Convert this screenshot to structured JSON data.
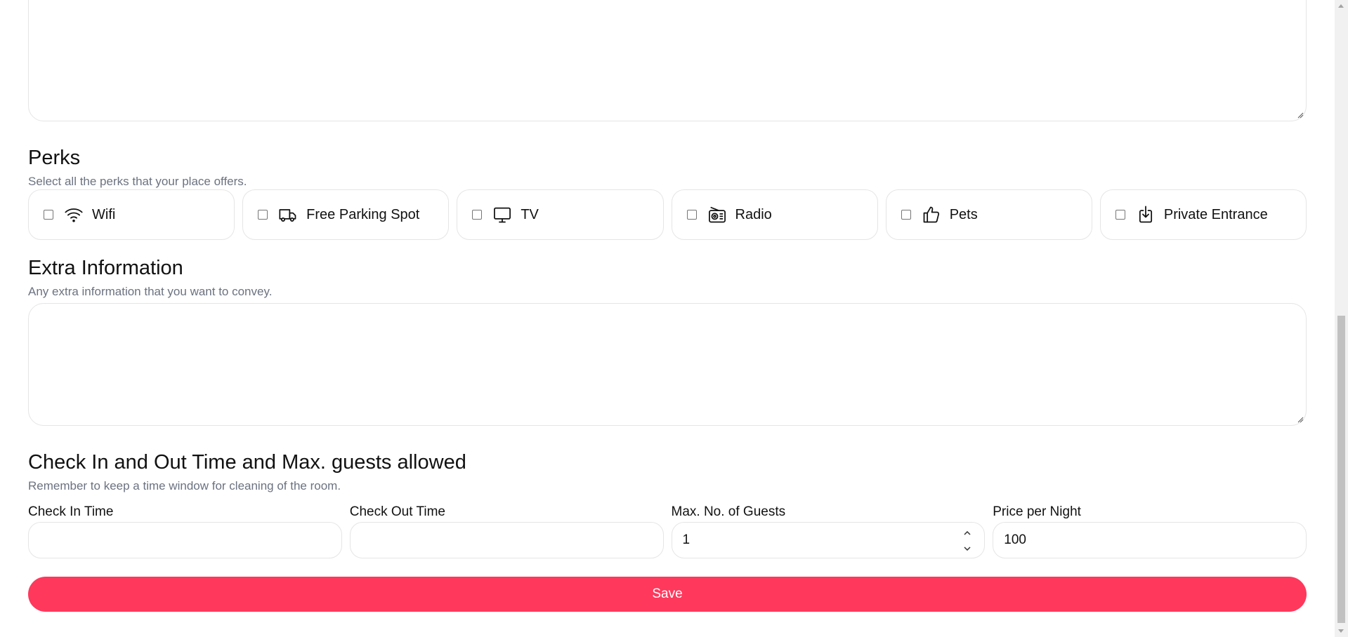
{
  "perks_section": {
    "title": "Perks",
    "subtitle": "Select all the perks that your place offers.",
    "items": [
      {
        "label": "Wifi",
        "icon": "wifi-icon",
        "checked": false
      },
      {
        "label": "Free Parking Spot",
        "icon": "truck-icon",
        "checked": false
      },
      {
        "label": "TV",
        "icon": "tv-icon",
        "checked": false
      },
      {
        "label": "Radio",
        "icon": "radio-icon",
        "checked": false
      },
      {
        "label": "Pets",
        "icon": "thumbs-up-icon",
        "checked": false
      },
      {
        "label": "Private Entrance",
        "icon": "entrance-icon",
        "checked": false
      }
    ]
  },
  "extra_section": {
    "title": "Extra Information",
    "subtitle": "Any extra information that you want to convey.",
    "value": ""
  },
  "times_section": {
    "title": "Check In and Out Time and Max. guests allowed",
    "subtitle": "Remember to keep a time window for cleaning of the room.",
    "fields": [
      {
        "label": "Check In Time",
        "value": ""
      },
      {
        "label": "Check Out Time",
        "value": ""
      },
      {
        "label": "Max. No. of Guests",
        "value": "1"
      },
      {
        "label": "Price per Night",
        "value": "100"
      }
    ]
  },
  "save_label": "Save",
  "colors": {
    "accent": "#ff385c",
    "border": "#e5e5e5",
    "muted_text": "#6b7280"
  }
}
